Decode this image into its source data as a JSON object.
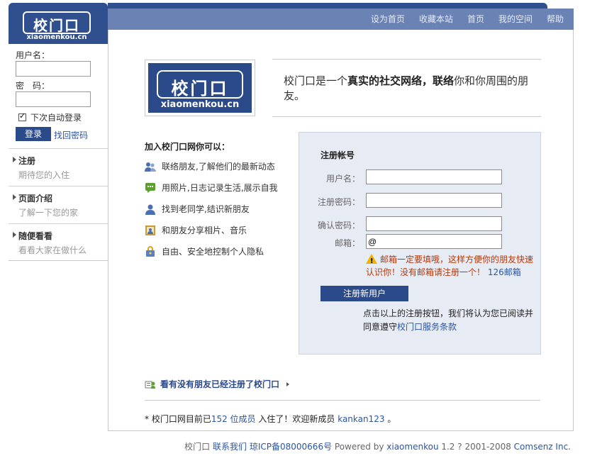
{
  "logo": {
    "cn": "校门口",
    "en": "xiaomenkou.cn"
  },
  "nav": [
    "设为首页",
    "收藏本站",
    "首页",
    "我的空间",
    "帮助"
  ],
  "login": {
    "username_label": "用户名：",
    "password_label": "密　码：",
    "remember_label": "下次自动登录",
    "login_button": "登录",
    "forgot_link": "找回密码"
  },
  "sidebar": {
    "sections": [
      {
        "title": "注册",
        "subtitle": "期待您的入住"
      },
      {
        "title": "页面介绍",
        "subtitle": "了解一下您的家"
      },
      {
        "title": "随便看看",
        "subtitle": "看看大家在做什么"
      }
    ]
  },
  "slogan": {
    "p1": "校门口是一个",
    "b1": "真实的社交网络，联络",
    "p2": "你和你周围的朋友。"
  },
  "features": {
    "title": "加入校门口网你可以：",
    "items": [
      {
        "icon": "users-icon",
        "text": "联络朋友,了解他们的最新动态"
      },
      {
        "icon": "comment-icon",
        "text": "用照片,日志记录生活,展示自我"
      },
      {
        "icon": "user-icon",
        "text": "找到老同学,结识新朋友"
      },
      {
        "icon": "photo-icon",
        "text": "和朋友分享相片、音乐"
      },
      {
        "icon": "lock-icon",
        "text": "自由、安全地控制个人隐私"
      }
    ]
  },
  "register": {
    "title": "注册帐号",
    "username_label": "用户名：",
    "password_label": "注册密码：",
    "confirm_label": "确认密码：",
    "email_label": "邮箱：",
    "email_value": "@",
    "warning_text": "邮箱一定要填哦，这样方便你的朋友快速认识你！没有邮箱请注册一个！",
    "warning_link": "126邮箱",
    "button": "注册新用户",
    "agree_text": "点击以上的注册按钮，我们将认为您已阅读并同意遵守",
    "agree_link": "校门口服务条款"
  },
  "see_friends": "看有没有朋友已经注册了校门口",
  "stats": {
    "prefix": "* 校门口网目前已",
    "count": "152 位成员",
    "middle": " 入住了！欢迎新成员 ",
    "member": "kankan123",
    "suffix": " 。"
  },
  "footer": {
    "site": "校门口",
    "contact": "联系我们",
    "icp": "琼ICP备08000666号",
    "powered": " Powered by ",
    "brand": "xiaomenkou",
    "version": " 1.2 ? 2001-2008 ",
    "company": "Comsenz Inc."
  },
  "colors": {
    "brand": "#2b4a8a",
    "header": "#6a83b4",
    "panel": "#e7ebf4",
    "link": "#2b55a5",
    "warning": "#b13a0e"
  }
}
